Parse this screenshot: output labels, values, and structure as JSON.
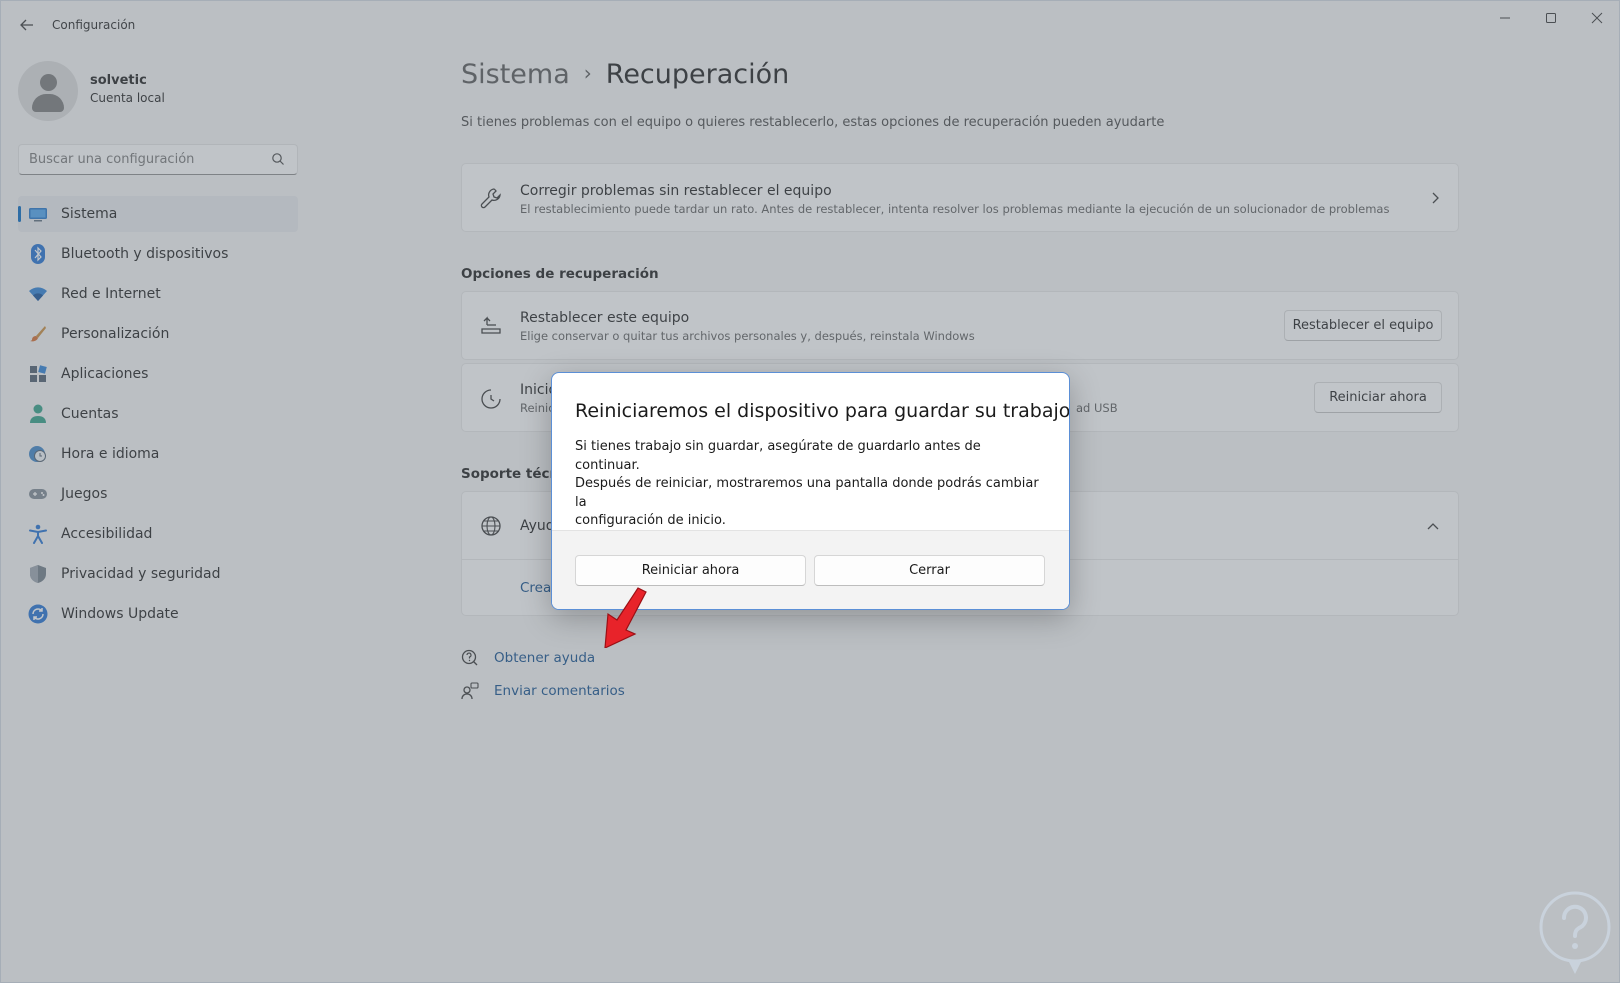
{
  "window": {
    "title": "Configuración",
    "controls": {
      "minimize": "─",
      "maximize": "☐",
      "close": "✕"
    }
  },
  "profile": {
    "name": "solvetic",
    "account_type": "Cuenta local"
  },
  "search": {
    "placeholder": "Buscar una configuración"
  },
  "sidebar": {
    "items": [
      {
        "label": "Sistema",
        "icon": "monitor-icon",
        "selected": true
      },
      {
        "label": "Bluetooth y dispositivos",
        "icon": "bluetooth-icon"
      },
      {
        "label": "Red e Internet",
        "icon": "wifi-icon"
      },
      {
        "label": "Personalización",
        "icon": "brush-icon"
      },
      {
        "label": "Aplicaciones",
        "icon": "apps-icon"
      },
      {
        "label": "Cuentas",
        "icon": "person-icon"
      },
      {
        "label": "Hora e idioma",
        "icon": "clock-globe-icon"
      },
      {
        "label": "Juegos",
        "icon": "gamepad-icon"
      },
      {
        "label": "Accesibilidad",
        "icon": "accessibility-icon"
      },
      {
        "label": "Privacidad y seguridad",
        "icon": "shield-icon"
      },
      {
        "label": "Windows Update",
        "icon": "update-icon"
      }
    ],
    "accent_color": "#0067c0"
  },
  "main": {
    "breadcrumb_parent": "Sistema",
    "breadcrumb_separator": "›",
    "page_title": "Recuperación",
    "subtitle": "Si tienes problemas con el equipo o quieres restablecerlo, estas opciones de recuperación pueden ayudarte",
    "fix_card": {
      "title": "Corregir problemas sin restablecer el equipo",
      "description": "El restablecimiento puede tardar un rato. Antes de restablecer, intenta resolver los problemas mediante la ejecución de un solucionador de problemas"
    },
    "recovery_section_title": "Opciones de recuperación",
    "reset_card": {
      "title": "Restablecer este equipo",
      "description": "Elige conservar o quitar tus archivos personales y, después, reinstala Windows",
      "button": "Restablecer el equipo"
    },
    "advanced_card": {
      "title_visible": "Inicio",
      "description_visible": "Reinic",
      "description_tail": "ad USB",
      "button": "Reiniciar ahora"
    },
    "support_section_title": "Soporte técnic",
    "help_card": {
      "title_visible": "Ayud",
      "link_visible": "Crea"
    },
    "links": {
      "get_help": "Obtener ayuda",
      "send_feedback": "Enviar comentarios"
    }
  },
  "dialog": {
    "title": "Reiniciaremos el dispositivo para guardar su trabajo",
    "body_line1": "Si tienes trabajo sin guardar, asegúrate de guardarlo antes de continuar.",
    "body_line2": "Después de reiniciar, mostraremos una pantalla donde podrás cambiar la",
    "body_line3": "configuración de inicio.",
    "primary_button": "Reiniciar ahora",
    "secondary_button": "Cerrar",
    "border_color": "#5b8fd6"
  },
  "annotation": {
    "arrow_color": "#e8232a"
  }
}
